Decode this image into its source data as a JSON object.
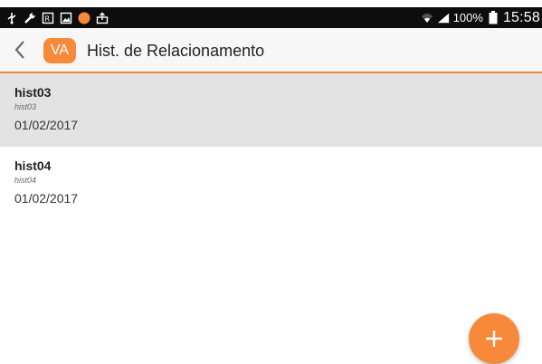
{
  "status_bar": {
    "left_icons": [
      "usb-icon",
      "wrench-icon",
      "prescription-icon",
      "image-icon",
      "app-notification-icon",
      "upload-icon"
    ],
    "battery_text": "100%",
    "clock": "15:58"
  },
  "toolbar": {
    "logo_text": "VA",
    "title": "Hist. de Relacionamento"
  },
  "items": [
    {
      "title": "hist03",
      "subtitle": "hist03",
      "date": "01/02/2017",
      "selected": true
    },
    {
      "title": "hist04",
      "subtitle": "hist04",
      "date": "01/02/2017",
      "selected": false
    }
  ],
  "colors": {
    "accent": "#f7893a",
    "selected_row": "#e3e3e3",
    "status_bar": "#0d0d0d"
  }
}
